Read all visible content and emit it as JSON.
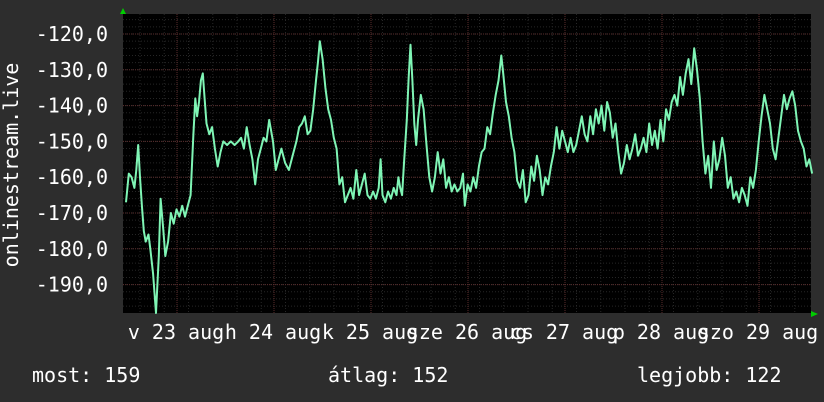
{
  "colors": {
    "background": "#2d2d2d",
    "plot_background": "#000000",
    "line": "#7ff5b5",
    "grid_major": "#5a2d2d",
    "grid_minor": "#262626",
    "text": "#ffffff",
    "axis_arrow": "#00cc00"
  },
  "summary": {
    "now": "most: 159",
    "avg": "átlag: 152",
    "best": "legjobb: 122"
  },
  "chart_data": {
    "type": "line",
    "title": "",
    "xlabel": "",
    "ylabel": "onlinestream.live",
    "ylim": [
      -200,
      -115
    ],
    "y_ticks": [
      -120,
      -130,
      -140,
      -150,
      -160,
      -170,
      -180,
      -190
    ],
    "y_tick_labels": [
      "-120,0",
      "-130,0",
      "-140,0",
      "-150,0",
      "-160,0",
      "-170,0",
      "-180,0",
      "-190,0"
    ],
    "x_labels": [
      {
        "text": "v 23 aug",
        "day": 0.0
      },
      {
        "text": "h 24 aug",
        "day": 1.0
      },
      {
        "text": "k 25 aug",
        "day": 2.0
      },
      {
        "text": "sze 26 aug",
        "day": 3.0
      },
      {
        "text": "cs 27 aug",
        "day": 4.0
      },
      {
        "text": "p 28 aug",
        "day": 5.0
      },
      {
        "text": "szo 29 aug",
        "day": 6.0
      }
    ],
    "xlim": [
      0,
      6.85
    ],
    "grid": true,
    "series": [
      {
        "values": [
          [
            0.0,
            -167
          ],
          [
            0.03,
            -159
          ],
          [
            0.06,
            -160
          ],
          [
            0.09,
            -163
          ],
          [
            0.11,
            -158
          ],
          [
            0.13,
            -151
          ],
          [
            0.15,
            -160
          ],
          [
            0.17,
            -168
          ],
          [
            0.19,
            -175
          ],
          [
            0.21,
            -178
          ],
          [
            0.24,
            -176
          ],
          [
            0.26,
            -180
          ],
          [
            0.29,
            -187
          ],
          [
            0.32,
            -199
          ],
          [
            0.35,
            -182
          ],
          [
            0.37,
            -166
          ],
          [
            0.4,
            -175
          ],
          [
            0.42,
            -182
          ],
          [
            0.45,
            -178
          ],
          [
            0.48,
            -170
          ],
          [
            0.51,
            -173
          ],
          [
            0.54,
            -169
          ],
          [
            0.57,
            -171
          ],
          [
            0.6,
            -168
          ],
          [
            0.63,
            -171
          ],
          [
            0.66,
            -168
          ],
          [
            0.69,
            -165
          ],
          [
            0.72,
            -148
          ],
          [
            0.74,
            -138
          ],
          [
            0.76,
            -143
          ],
          [
            0.78,
            -139
          ],
          [
            0.8,
            -133
          ],
          [
            0.82,
            -131
          ],
          [
            0.84,
            -138
          ],
          [
            0.86,
            -145
          ],
          [
            0.89,
            -148
          ],
          [
            0.92,
            -146
          ],
          [
            0.95,
            -152
          ],
          [
            0.98,
            -157
          ],
          [
            1.01,
            -153
          ],
          [
            1.04,
            -150
          ],
          [
            1.08,
            -151
          ],
          [
            1.12,
            -150
          ],
          [
            1.16,
            -151
          ],
          [
            1.2,
            -150
          ],
          [
            1.23,
            -149
          ],
          [
            1.26,
            -152
          ],
          [
            1.29,
            -146
          ],
          [
            1.32,
            -151
          ],
          [
            1.35,
            -155
          ],
          [
            1.38,
            -162
          ],
          [
            1.41,
            -155
          ],
          [
            1.44,
            -152
          ],
          [
            1.47,
            -149
          ],
          [
            1.5,
            -150
          ],
          [
            1.53,
            -144
          ],
          [
            1.57,
            -150
          ],
          [
            1.6,
            -158
          ],
          [
            1.63,
            -155
          ],
          [
            1.66,
            -152
          ],
          [
            1.7,
            -156
          ],
          [
            1.74,
            -158
          ],
          [
            1.78,
            -154
          ],
          [
            1.82,
            -150
          ],
          [
            1.85,
            -146
          ],
          [
            1.88,
            -145
          ],
          [
            1.91,
            -143
          ],
          [
            1.94,
            -148
          ],
          [
            1.97,
            -147
          ],
          [
            2.0,
            -141
          ],
          [
            2.03,
            -133
          ],
          [
            2.05,
            -128
          ],
          [
            2.07,
            -122
          ],
          [
            2.1,
            -127
          ],
          [
            2.13,
            -135
          ],
          [
            2.16,
            -141
          ],
          [
            2.19,
            -144
          ],
          [
            2.22,
            -149
          ],
          [
            2.25,
            -152
          ],
          [
            2.28,
            -162
          ],
          [
            2.31,
            -160
          ],
          [
            2.34,
            -167
          ],
          [
            2.37,
            -165
          ],
          [
            2.4,
            -163
          ],
          [
            2.43,
            -166
          ],
          [
            2.46,
            -158
          ],
          [
            2.49,
            -165
          ],
          [
            2.52,
            -162
          ],
          [
            2.55,
            -159
          ],
          [
            2.58,
            -165
          ],
          [
            2.61,
            -166
          ],
          [
            2.64,
            -164
          ],
          [
            2.67,
            -166
          ],
          [
            2.7,
            -163
          ],
          [
            2.72,
            -155
          ],
          [
            2.74,
            -165
          ],
          [
            2.77,
            -167
          ],
          [
            2.8,
            -164
          ],
          [
            2.83,
            -166
          ],
          [
            2.86,
            -163
          ],
          [
            2.89,
            -165
          ],
          [
            2.91,
            -160
          ],
          [
            2.93,
            -163
          ],
          [
            2.95,
            -165
          ],
          [
            2.97,
            -156
          ],
          [
            3.0,
            -144
          ],
          [
            3.02,
            -132
          ],
          [
            3.04,
            -123
          ],
          [
            3.06,
            -133
          ],
          [
            3.08,
            -145
          ],
          [
            3.1,
            -151
          ],
          [
            3.12,
            -144
          ],
          [
            3.15,
            -137
          ],
          [
            3.18,
            -141
          ],
          [
            3.21,
            -151
          ],
          [
            3.24,
            -160
          ],
          [
            3.27,
            -164
          ],
          [
            3.3,
            -160
          ],
          [
            3.33,
            -153
          ],
          [
            3.36,
            -159
          ],
          [
            3.39,
            -155
          ],
          [
            3.42,
            -163
          ],
          [
            3.45,
            -160
          ],
          [
            3.48,
            -164
          ],
          [
            3.51,
            -162
          ],
          [
            3.54,
            -164
          ],
          [
            3.57,
            -163
          ],
          [
            3.6,
            -159
          ],
          [
            3.62,
            -168
          ],
          [
            3.65,
            -162
          ],
          [
            3.68,
            -164
          ],
          [
            3.71,
            -160
          ],
          [
            3.74,
            -163
          ],
          [
            3.77,
            -157
          ],
          [
            3.8,
            -153
          ],
          [
            3.83,
            -152
          ],
          [
            3.86,
            -146
          ],
          [
            3.89,
            -148
          ],
          [
            3.92,
            -142
          ],
          [
            3.95,
            -137
          ],
          [
            3.98,
            -133
          ],
          [
            4.01,
            -126
          ],
          [
            4.03,
            -131
          ],
          [
            4.06,
            -139
          ],
          [
            4.09,
            -143
          ],
          [
            4.12,
            -149
          ],
          [
            4.15,
            -153
          ],
          [
            4.18,
            -161
          ],
          [
            4.21,
            -163
          ],
          [
            4.24,
            -158
          ],
          [
            4.27,
            -167
          ],
          [
            4.3,
            -165
          ],
          [
            4.33,
            -157
          ],
          [
            4.36,
            -161
          ],
          [
            4.39,
            -154
          ],
          [
            4.42,
            -158
          ],
          [
            4.45,
            -165
          ],
          [
            4.48,
            -160
          ],
          [
            4.51,
            -162
          ],
          [
            4.54,
            -157
          ],
          [
            4.57,
            -153
          ],
          [
            4.6,
            -146
          ],
          [
            4.63,
            -152
          ],
          [
            4.66,
            -147
          ],
          [
            4.69,
            -150
          ],
          [
            4.72,
            -153
          ],
          [
            4.75,
            -149
          ],
          [
            4.78,
            -153
          ],
          [
            4.81,
            -151
          ],
          [
            4.84,
            -147
          ],
          [
            4.87,
            -143
          ],
          [
            4.9,
            -148
          ],
          [
            4.93,
            -150
          ],
          [
            4.96,
            -143
          ],
          [
            4.99,
            -148
          ],
          [
            5.02,
            -141
          ],
          [
            5.05,
            -145
          ],
          [
            5.08,
            -140
          ],
          [
            5.11,
            -147
          ],
          [
            5.14,
            -139
          ],
          [
            5.17,
            -142
          ],
          [
            5.2,
            -149
          ],
          [
            5.23,
            -145
          ],
          [
            5.26,
            -153
          ],
          [
            5.29,
            -159
          ],
          [
            5.32,
            -156
          ],
          [
            5.35,
            -151
          ],
          [
            5.38,
            -155
          ],
          [
            5.41,
            -152
          ],
          [
            5.44,
            -148
          ],
          [
            5.47,
            -154
          ],
          [
            5.5,
            -152
          ],
          [
            5.53,
            -149
          ],
          [
            5.56,
            -153
          ],
          [
            5.59,
            -145
          ],
          [
            5.62,
            -151
          ],
          [
            5.65,
            -147
          ],
          [
            5.68,
            -152
          ],
          [
            5.71,
            -144
          ],
          [
            5.74,
            -150
          ],
          [
            5.77,
            -141
          ],
          [
            5.8,
            -144
          ],
          [
            5.83,
            -139
          ],
          [
            5.86,
            -137
          ],
          [
            5.89,
            -140
          ],
          [
            5.92,
            -132
          ],
          [
            5.95,
            -137
          ],
          [
            5.98,
            -131
          ],
          [
            6.01,
            -127
          ],
          [
            6.04,
            -134
          ],
          [
            6.07,
            -124
          ],
          [
            6.1,
            -130
          ],
          [
            6.13,
            -138
          ],
          [
            6.16,
            -150
          ],
          [
            6.19,
            -159
          ],
          [
            6.22,
            -154
          ],
          [
            6.25,
            -163
          ],
          [
            6.28,
            -150
          ],
          [
            6.31,
            -158
          ],
          [
            6.34,
            -155
          ],
          [
            6.37,
            -149
          ],
          [
            6.4,
            -154
          ],
          [
            6.43,
            -163
          ],
          [
            6.46,
            -160
          ],
          [
            6.49,
            -166
          ],
          [
            6.52,
            -164
          ],
          [
            6.55,
            -167
          ],
          [
            6.58,
            -163
          ],
          [
            6.61,
            -165
          ],
          [
            6.64,
            -168
          ],
          [
            6.67,
            -160
          ],
          [
            6.7,
            -163
          ],
          [
            6.73,
            -158
          ],
          [
            6.76,
            -150
          ],
          [
            6.79,
            -143
          ],
          [
            6.82,
            -137
          ],
          [
            6.85,
            -141
          ],
          [
            6.88,
            -145
          ],
          [
            6.91,
            -152
          ],
          [
            6.94,
            -155
          ],
          [
            6.97,
            -149
          ],
          [
            7.0,
            -143
          ],
          [
            7.03,
            -137
          ],
          [
            7.06,
            -141
          ],
          [
            7.09,
            -138
          ],
          [
            7.12,
            -136
          ],
          [
            7.15,
            -140
          ],
          [
            7.18,
            -147
          ],
          [
            7.21,
            -150
          ],
          [
            7.24,
            -152
          ],
          [
            7.27,
            -157
          ],
          [
            7.3,
            -155
          ],
          [
            7.33,
            -159
          ]
        ]
      }
    ]
  }
}
